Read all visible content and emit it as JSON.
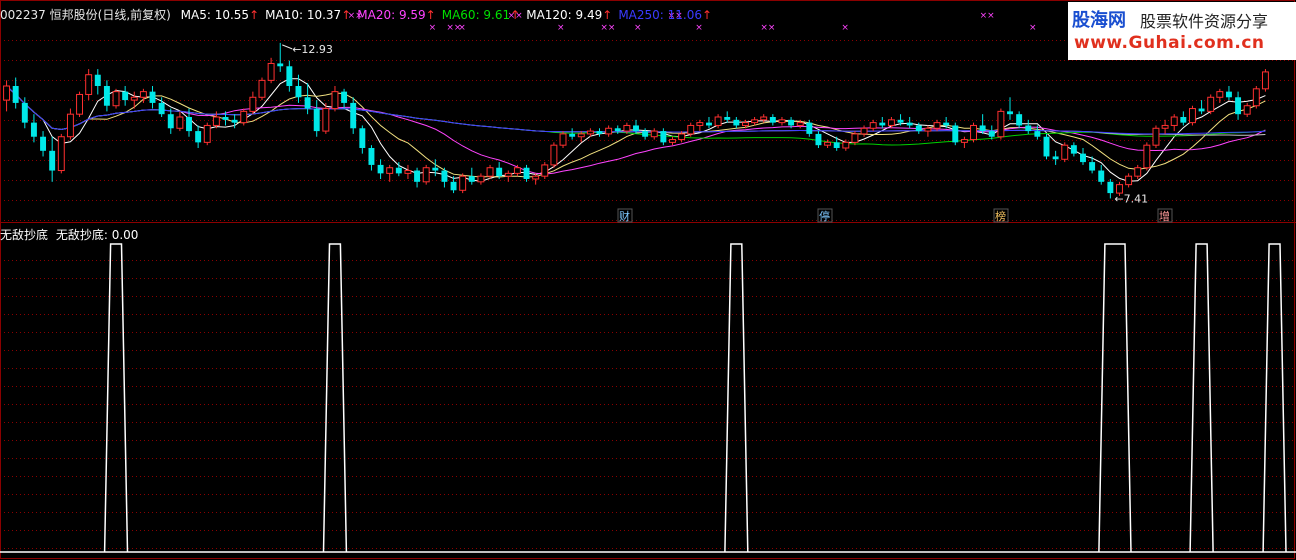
{
  "header": {
    "code": "002237",
    "name": "恒邦股份(日线,前复权)",
    "ma_labels": [
      {
        "text": "MA5: 10.55",
        "color": "#ffffff",
        "arrow": "↑"
      },
      {
        "text": "MA10: 10.37",
        "color": "#ffffff",
        "arrow": "↑"
      },
      {
        "text": "MA20: 9.59",
        "color": "#ff44ff",
        "arrow": "↑"
      },
      {
        "text": "MA60: 9.61",
        "color": "#00e000",
        "arrow": "↑"
      },
      {
        "text": "MA120: 9.49",
        "color": "#ffffff",
        "arrow": "↑"
      },
      {
        "text": "MA250: 11.06",
        "color": "#3a3aff",
        "arrow": "↑"
      }
    ]
  },
  "indicator_header": {
    "title": "无敌抄底",
    "value_label": "无敌抄底: 0.00"
  },
  "logo": {
    "brand": "股海网",
    "slogan": "股票软件资源分享",
    "url": "www.Guhai.com.cn"
  },
  "colors": {
    "background": "#000000",
    "grid": "#8b0000",
    "up": "#ff3030",
    "down": "#00e8e8",
    "indicator": "#ffffff"
  },
  "chart_data": [
    {
      "type": "candlestick",
      "title": "002237 恒邦股份(日线,前复权)",
      "annotations": [
        {
          "text": "12.93",
          "kind": "high"
        },
        {
          "text": "7.41",
          "kind": "low"
        }
      ],
      "event_markers": [
        "财",
        "停",
        "榜",
        "增"
      ],
      "ylim": [
        7.0,
        13.6
      ],
      "candles": [
        [
          10.9,
          11.6,
          10.5,
          11.4
        ],
        [
          11.4,
          11.7,
          10.6,
          10.8
        ],
        [
          10.8,
          11.0,
          9.9,
          10.1
        ],
        [
          10.1,
          10.4,
          9.4,
          9.6
        ],
        [
          9.6,
          9.8,
          8.9,
          9.1
        ],
        [
          9.1,
          9.6,
          8.0,
          8.4
        ],
        [
          8.4,
          9.7,
          8.3,
          9.6
        ],
        [
          9.6,
          10.6,
          9.5,
          10.4
        ],
        [
          10.4,
          11.2,
          10.3,
          11.1
        ],
        [
          11.1,
          12.0,
          10.9,
          11.8
        ],
        [
          11.8,
          12.0,
          11.1,
          11.4
        ],
        [
          11.4,
          11.6,
          10.5,
          10.7
        ],
        [
          10.7,
          11.3,
          10.6,
          11.2
        ],
        [
          11.2,
          11.4,
          10.7,
          10.9
        ],
        [
          10.9,
          11.2,
          10.6,
          11.0
        ],
        [
          11.0,
          11.3,
          10.8,
          11.2
        ],
        [
          11.2,
          11.4,
          10.6,
          10.8
        ],
        [
          10.8,
          11.0,
          10.3,
          10.4
        ],
        [
          10.4,
          10.6,
          9.7,
          9.9
        ],
        [
          9.9,
          10.5,
          9.8,
          10.3
        ],
        [
          10.3,
          10.6,
          9.6,
          9.8
        ],
        [
          9.8,
          10.0,
          9.2,
          9.4
        ],
        [
          9.4,
          10.1,
          9.3,
          10.0
        ],
        [
          10.0,
          10.5,
          9.9,
          10.3
        ],
        [
          10.3,
          10.5,
          10.0,
          10.2
        ],
        [
          10.2,
          10.4,
          9.9,
          10.1
        ],
        [
          10.1,
          10.6,
          10.0,
          10.5
        ],
        [
          10.5,
          11.2,
          10.4,
          11.0
        ],
        [
          11.0,
          11.7,
          10.9,
          11.6
        ],
        [
          11.6,
          12.4,
          11.5,
          12.2
        ],
        [
          12.2,
          12.93,
          11.9,
          12.1
        ],
        [
          12.1,
          12.3,
          11.2,
          11.4
        ],
        [
          11.4,
          11.8,
          10.8,
          11.0
        ],
        [
          11.0,
          11.5,
          10.4,
          10.6
        ],
        [
          10.6,
          10.9,
          9.6,
          9.8
        ],
        [
          9.8,
          10.8,
          9.7,
          10.6
        ],
        [
          10.6,
          11.4,
          10.5,
          11.2
        ],
        [
          11.2,
          11.3,
          10.6,
          10.8
        ],
        [
          10.8,
          11.0,
          9.7,
          9.9
        ],
        [
          9.9,
          10.0,
          9.0,
          9.2
        ],
        [
          9.2,
          9.3,
          8.4,
          8.6
        ],
        [
          8.6,
          8.8,
          8.1,
          8.3
        ],
        [
          8.3,
          8.6,
          8.0,
          8.5
        ],
        [
          8.5,
          8.7,
          8.2,
          8.3
        ],
        [
          8.3,
          8.6,
          8.1,
          8.4
        ],
        [
          8.4,
          8.5,
          7.8,
          8.0
        ],
        [
          8.0,
          8.6,
          7.9,
          8.5
        ],
        [
          8.5,
          8.8,
          8.2,
          8.4
        ],
        [
          8.4,
          8.5,
          7.8,
          8.0
        ],
        [
          8.0,
          8.2,
          7.6,
          7.7
        ],
        [
          7.7,
          8.3,
          7.6,
          8.2
        ],
        [
          8.2,
          8.5,
          7.9,
          8.0
        ],
        [
          8.0,
          8.3,
          7.9,
          8.2
        ],
        [
          8.2,
          8.6,
          8.1,
          8.5
        ],
        [
          8.5,
          8.7,
          8.1,
          8.2
        ],
        [
          8.2,
          8.4,
          8.0,
          8.3
        ],
        [
          8.3,
          8.6,
          8.2,
          8.5
        ],
        [
          8.5,
          8.6,
          8.0,
          8.1
        ],
        [
          8.1,
          8.3,
          7.9,
          8.2
        ],
        [
          8.2,
          8.7,
          8.1,
          8.6
        ],
        [
          8.6,
          9.4,
          8.5,
          9.3
        ],
        [
          9.3,
          9.8,
          9.2,
          9.7
        ],
        [
          9.7,
          9.9,
          9.5,
          9.6
        ],
        [
          9.6,
          9.8,
          9.4,
          9.7
        ],
        [
          9.7,
          9.9,
          9.6,
          9.8
        ],
        [
          9.8,
          9.9,
          9.6,
          9.7
        ],
        [
          9.7,
          10.0,
          9.6,
          9.9
        ],
        [
          9.9,
          10.0,
          9.7,
          9.8
        ],
        [
          9.8,
          10.1,
          9.7,
          10.0
        ],
        [
          10.0,
          10.2,
          9.7,
          9.8
        ],
        [
          9.8,
          9.9,
          9.5,
          9.6
        ],
        [
          9.6,
          9.9,
          9.5,
          9.8
        ],
        [
          9.8,
          9.9,
          9.3,
          9.4
        ],
        [
          9.4,
          9.6,
          9.3,
          9.5
        ],
        [
          9.5,
          9.8,
          9.4,
          9.7
        ],
        [
          9.7,
          10.1,
          9.6,
          10.0
        ],
        [
          10.0,
          10.2,
          9.8,
          10.1
        ],
        [
          10.1,
          10.3,
          9.9,
          10.0
        ],
        [
          10.0,
          10.4,
          9.9,
          10.3
        ],
        [
          10.3,
          10.5,
          10.1,
          10.2
        ],
        [
          10.2,
          10.3,
          9.9,
          10.0
        ],
        [
          10.0,
          10.2,
          9.9,
          10.1
        ],
        [
          10.1,
          10.3,
          10.0,
          10.2
        ],
        [
          10.2,
          10.4,
          10.1,
          10.3
        ],
        [
          10.3,
          10.4,
          10.0,
          10.1
        ],
        [
          10.1,
          10.3,
          10.0,
          10.2
        ],
        [
          10.2,
          10.3,
          9.9,
          10.0
        ],
        [
          10.0,
          10.2,
          9.9,
          10.1
        ],
        [
          10.1,
          10.2,
          9.6,
          9.7
        ],
        [
          9.7,
          9.8,
          9.2,
          9.3
        ],
        [
          9.3,
          9.5,
          9.2,
          9.4
        ],
        [
          9.4,
          9.6,
          9.1,
          9.2
        ],
        [
          9.2,
          9.5,
          9.1,
          9.4
        ],
        [
          9.4,
          9.8,
          9.3,
          9.7
        ],
        [
          9.7,
          10.0,
          9.6,
          9.9
        ],
        [
          9.9,
          10.2,
          9.8,
          10.1
        ],
        [
          10.1,
          10.3,
          9.9,
          10.0
        ],
        [
          10.0,
          10.3,
          9.9,
          10.2
        ],
        [
          10.2,
          10.4,
          10.0,
          10.1
        ],
        [
          10.1,
          10.3,
          9.9,
          10.0
        ],
        [
          10.0,
          10.1,
          9.7,
          9.8
        ],
        [
          9.8,
          10.0,
          9.6,
          9.9
        ],
        [
          9.9,
          10.2,
          9.8,
          10.1
        ],
        [
          10.1,
          10.3,
          9.9,
          10.0
        ],
        [
          10.0,
          10.1,
          9.3,
          9.4
        ],
        [
          9.4,
          9.6,
          9.2,
          9.5
        ],
        [
          9.5,
          10.1,
          9.4,
          10.0
        ],
        [
          10.0,
          10.4,
          9.7,
          9.8
        ],
        [
          9.8,
          10.0,
          9.5,
          9.6
        ],
        [
          9.6,
          10.6,
          9.5,
          10.5
        ],
        [
          10.5,
          11.0,
          10.2,
          10.4
        ],
        [
          10.4,
          10.5,
          9.9,
          10.0
        ],
        [
          10.0,
          10.2,
          9.7,
          9.8
        ],
        [
          9.8,
          10.0,
          9.5,
          9.6
        ],
        [
          9.6,
          9.7,
          8.8,
          8.9
        ],
        [
          8.9,
          9.1,
          8.6,
          8.8
        ],
        [
          8.8,
          9.4,
          8.7,
          9.3
        ],
        [
          9.3,
          9.4,
          8.9,
          9.0
        ],
        [
          9.0,
          9.2,
          8.6,
          8.7
        ],
        [
          8.7,
          8.9,
          8.3,
          8.4
        ],
        [
          8.4,
          8.6,
          7.9,
          8.0
        ],
        [
          8.0,
          8.1,
          7.41,
          7.6
        ],
        [
          7.6,
          8.0,
          7.5,
          7.9
        ],
        [
          7.9,
          8.3,
          7.8,
          8.2
        ],
        [
          8.2,
          8.6,
          8.1,
          8.5
        ],
        [
          8.5,
          9.4,
          8.4,
          9.3
        ],
        [
          9.3,
          10.0,
          9.2,
          9.9
        ],
        [
          9.9,
          10.2,
          9.7,
          10.0
        ],
        [
          10.0,
          10.4,
          9.8,
          10.3
        ],
        [
          10.3,
          10.5,
          10.0,
          10.1
        ],
        [
          10.1,
          10.7,
          10.0,
          10.6
        ],
        [
          10.6,
          10.9,
          10.4,
          10.5
        ],
        [
          10.5,
          11.1,
          10.4,
          11.0
        ],
        [
          11.0,
          11.3,
          10.8,
          11.2
        ],
        [
          11.2,
          11.4,
          10.9,
          11.0
        ],
        [
          11.0,
          11.2,
          10.2,
          10.4
        ],
        [
          10.4,
          10.8,
          10.3,
          10.7
        ],
        [
          10.7,
          11.4,
          10.6,
          11.3
        ],
        [
          11.3,
          12.0,
          11.2,
          11.9
        ]
      ]
    },
    {
      "type": "line",
      "title": "无敌抄底",
      "ylim": [
        0,
        1
      ],
      "signal_at_candle": [
        12,
        36,
        80,
        121,
        131,
        139
      ],
      "signal_width_candles": [
        1,
        1,
        1,
        2,
        1,
        1
      ],
      "values_note": "0/1 signal series"
    }
  ]
}
